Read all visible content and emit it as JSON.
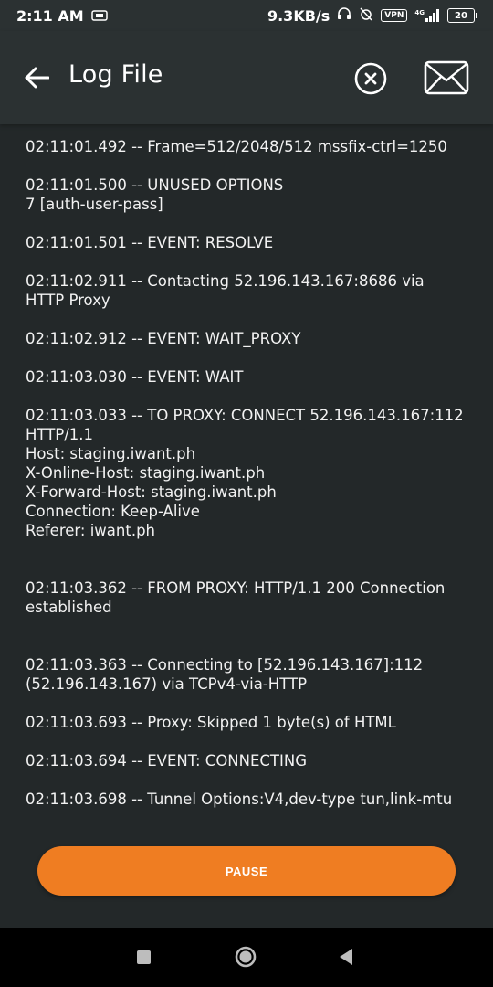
{
  "status_bar": {
    "time": "2:11 AM",
    "network_speed": "9.3KB/s",
    "vpn_label": "VPN",
    "signal_label": "4G",
    "battery": "20"
  },
  "app_bar": {
    "title": "Log File",
    "icons": [
      "back-arrow-icon",
      "clear-circle-x-icon",
      "mail-envelope-icon"
    ]
  },
  "log": {
    "entries": [
      "02:11:01.492 -- Frame=512/2048/512 mssfix-ctrl=1250",
      "02:11:01.500 -- UNUSED OPTIONS\n7 [auth-user-pass]",
      "02:11:01.501 -- EVENT: RESOLVE",
      "02:11:02.911 -- Contacting 52.196.143.167:8686 via HTTP Proxy",
      "02:11:02.912 -- EVENT: WAIT_PROXY",
      "02:11:03.030 -- EVENT: WAIT",
      "02:11:03.033 -- TO PROXY: CONNECT 52.196.143.167:112 HTTP/1.1\nHost: staging.iwant.ph\nX-Online-Host: staging.iwant.ph\nX-Forward-Host: staging.iwant.ph\nConnection: Keep-Alive\nReferer: iwant.ph",
      "02:11:03.362 -- FROM PROXY: HTTP/1.1 200 Connection established",
      "02:11:03.363 -- Connecting to [52.196.143.167]:112 (52.196.143.167) via TCPv4-via-HTTP",
      "02:11:03.693 -- Proxy: Skipped 1 byte(s) of HTML",
      "02:11:03.694 -- EVENT: CONNECTING",
      "02:11:03.698 -- Tunnel Options:V4,dev-type tun,link-mtu"
    ]
  },
  "pause_button": {
    "label": "PAUSE"
  },
  "colors": {
    "background": "#232829",
    "app_bar": "#2b3132",
    "accent": "#ef7d22"
  }
}
